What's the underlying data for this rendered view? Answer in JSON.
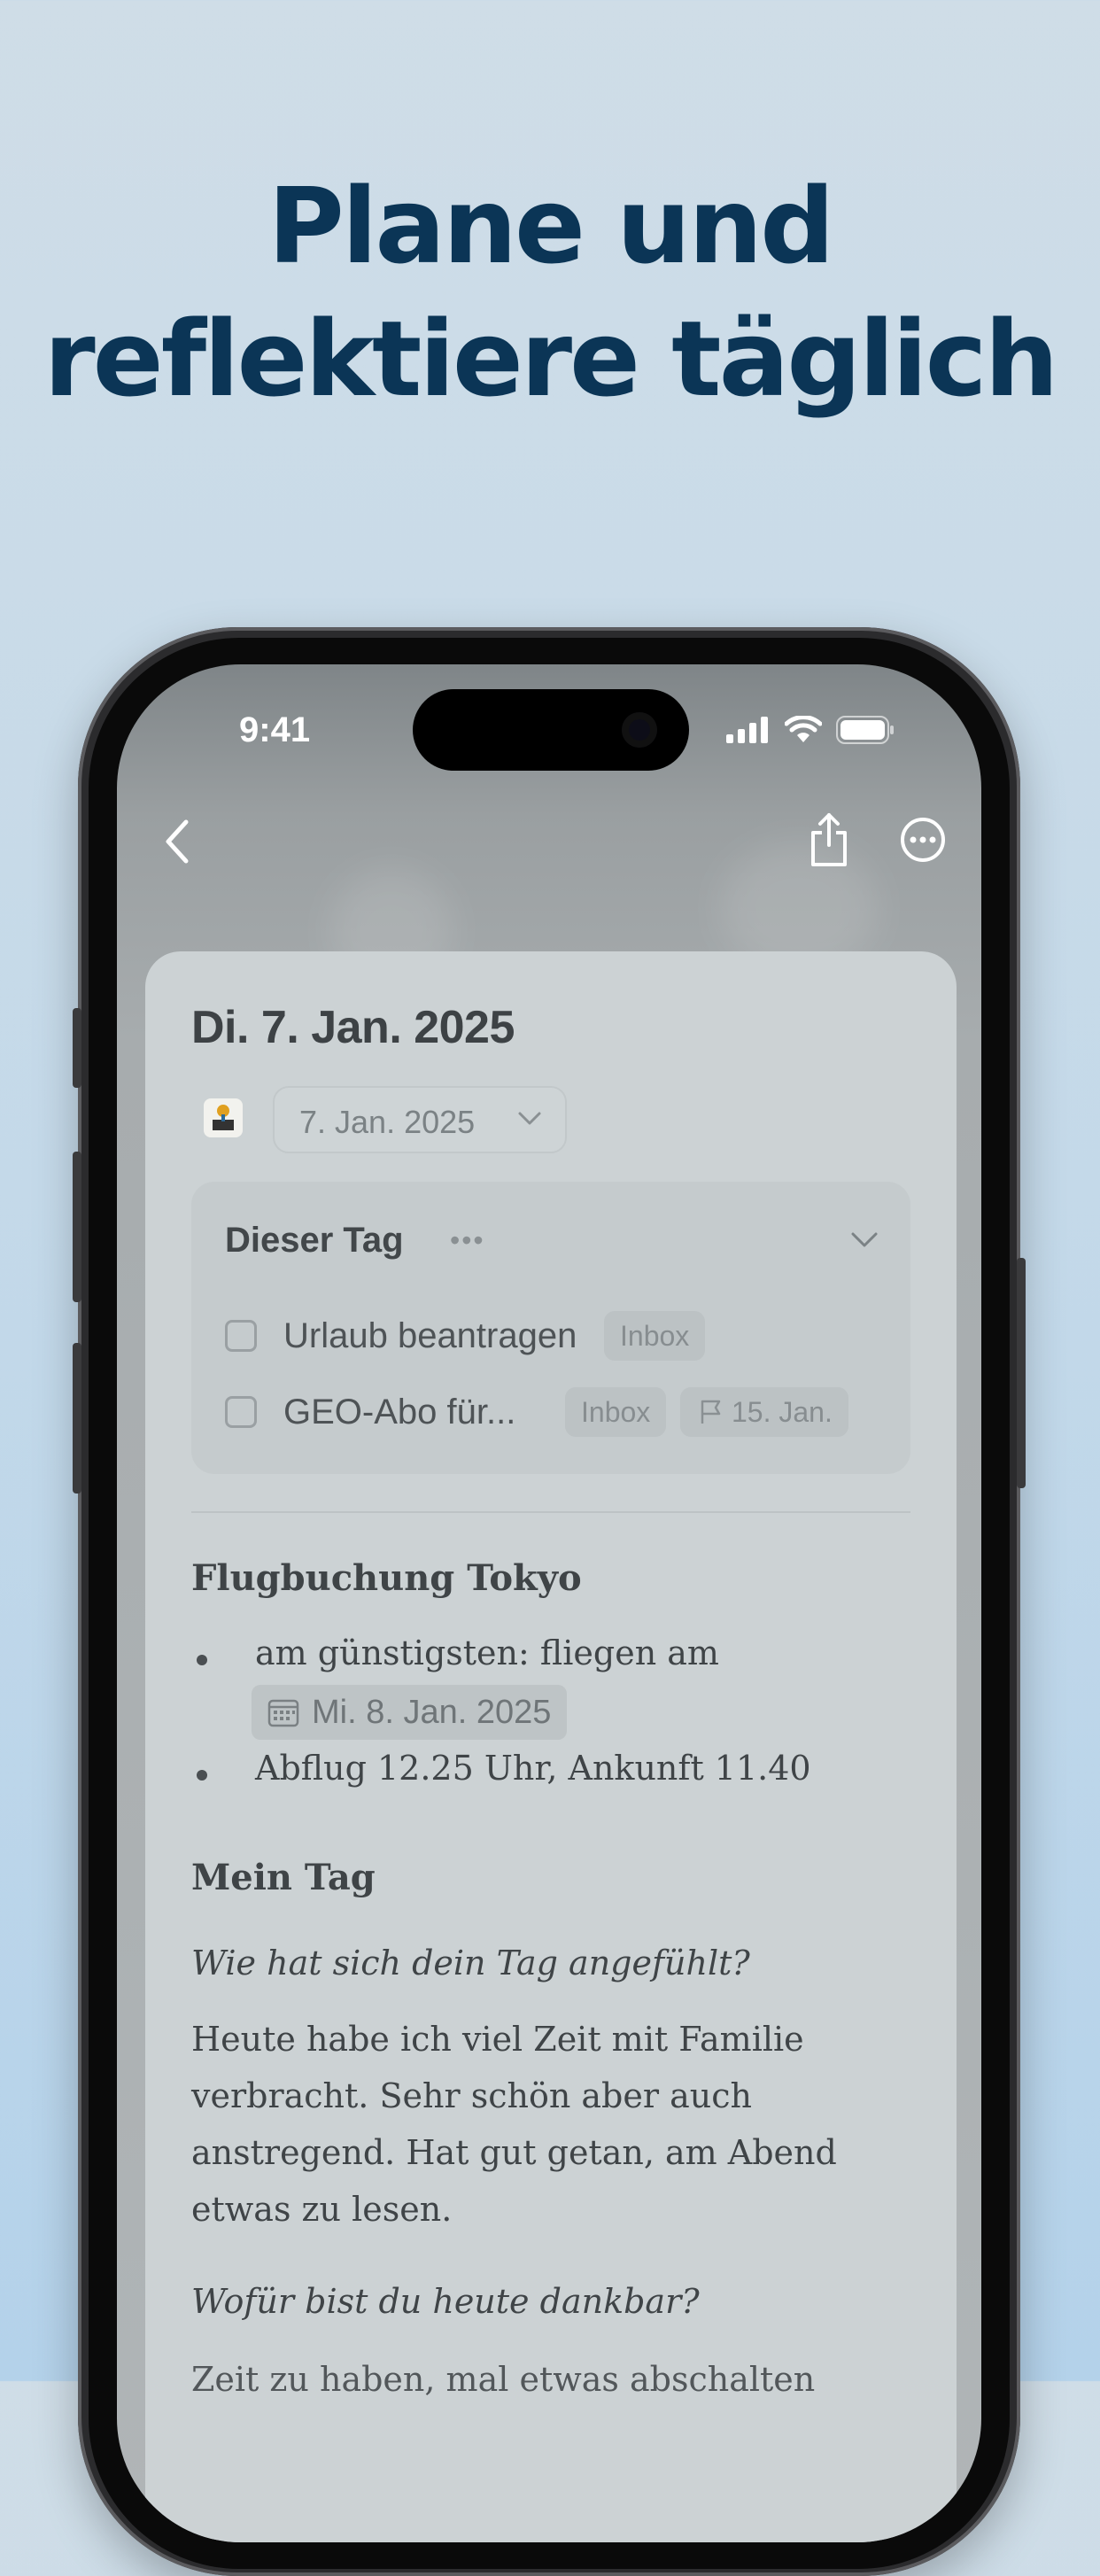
{
  "headline": {
    "line1": "Plane und",
    "line2": "reflektiere täglich"
  },
  "status_bar": {
    "time": "9:41"
  },
  "nav": {
    "back_icon": "chevron-left-icon",
    "share_icon": "share-icon",
    "more_icon": "ellipsis-circle-icon"
  },
  "note": {
    "title": "Di. 7. Jan. 2025",
    "date_picker": "7. Jan. 2025",
    "today_section": {
      "title": "Dieser Tag",
      "more": "•••",
      "tasks": [
        {
          "label": "Urlaub beantragen",
          "tag": "Inbox",
          "due": ""
        },
        {
          "label": "GEO-Abo für...",
          "tag": "Inbox",
          "due": "15. Jan."
        }
      ]
    },
    "flight": {
      "heading": "Flugbuchung Tokyo",
      "bullet1": "am günstigsten: fliegen am",
      "bullet1_date": "Mi. 8. Jan. 2025",
      "bullet2": "Abflug 12.25 Uhr, Ankunft 11.40"
    },
    "day": {
      "heading": "Mein Tag",
      "question1": "Wie hat sich dein Tag angefühlt?",
      "answer1_lines": [
        "Heute habe ich viel Zeit mit Familie",
        "verbracht. Sehr schön aber auch",
        "anstregend. Hat gut getan, am Abend",
        "etwas zu lesen."
      ],
      "question2": "Wofür bist du heute dankbar?",
      "answer2_partial": "Zeit zu haben, mal etwas abschalten"
    }
  }
}
